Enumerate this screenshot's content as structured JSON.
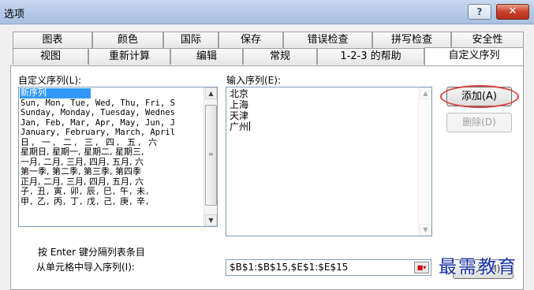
{
  "window": {
    "title": "选项",
    "help_glyph": "?",
    "close_glyph": "✕"
  },
  "tabs": {
    "row1": [
      "图表",
      "颜色",
      "国际",
      "保存",
      "错误检查",
      "拼写检查",
      "安全性"
    ],
    "row2": [
      "视图",
      "重新计算",
      "编辑",
      "常规",
      "1-2-3 的帮助",
      "自定义序列"
    ],
    "active": "自定义序列"
  },
  "custom_lists": {
    "label": "自定义序列(L):",
    "items": [
      "新序列",
      "Sun, Mon, Tue, Wed, Thu, Fri, S",
      "Sunday, Monday, Tuesday, Wednes",
      "Jan, Feb, Mar, Apr, May, Jun, J",
      "January, February, March, April",
      "日, 一, 二, 三, 四, 五, 六",
      "星期日, 星期一, 星期二, 星期三,",
      "一月, 二月, 三月, 四月, 五月, 六",
      "第一季, 第二季, 第三季, 第四季",
      "正月, 二月, 三月, 四月, 五月, 六",
      "子, 丑, 寅, 卯, 辰, 巳, 午, 未,",
      "甲, 乙, 丙, 丁, 戊, 己, 庚, 辛,"
    ],
    "selected_index": 0
  },
  "list_entries": {
    "label": "输入序列(E):",
    "lines": [
      "北京",
      "上海",
      "天津",
      "广州"
    ]
  },
  "buttons": {
    "add": "添加(A)",
    "delete": "删除(D)",
    "import": "导入(M)"
  },
  "hint": "按 Enter 键分隔列表条目",
  "import_section": {
    "label": "从单元格中导入序列(I):",
    "value": "$B$1:$B$15,$E$1:$E$15"
  },
  "watermark": "最需教育",
  "colors": {
    "highlight": "#3399ff",
    "annotation_ring": "#d7423b",
    "watermark": "#1b36a8"
  }
}
